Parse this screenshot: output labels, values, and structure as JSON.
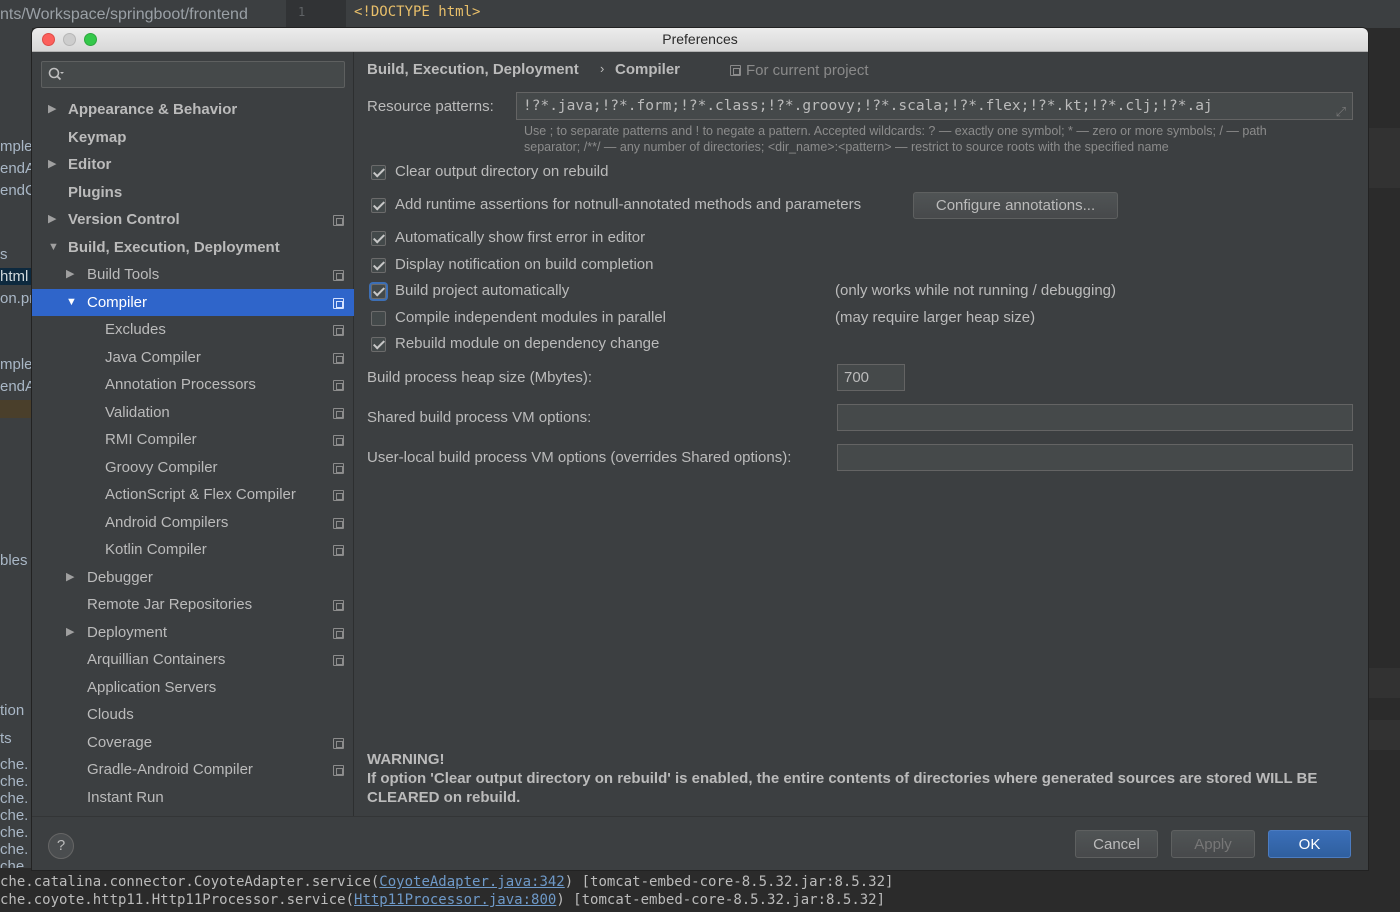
{
  "background": {
    "path": "nts/Workspace/springboot/frontend",
    "line_number": "1",
    "code": "<!DOCTYPE html>",
    "left_fragments": [
      "mple.",
      "endA",
      "endC",
      "s",
      "html",
      "on.pr",
      "mple.",
      "endA",
      "bles",
      "tion",
      "ts",
      "che.",
      "che.",
      "che.",
      "che.",
      "che.",
      "che.",
      "che."
    ],
    "console": [
      {
        "prefix": "che.catalina.connector.CoyoteAdapter.service(",
        "link": "CoyoteAdapter.java:342",
        "suffix": ") [tomcat-embed-core-8.5.32.jar:8.5.32]"
      },
      {
        "prefix": "che.coyote.http11.Http11Processor.service(",
        "link": "Http11Processor.java:800",
        "suffix": ") [tomcat-embed-core-8.5.32.jar:8.5.32]"
      }
    ]
  },
  "dialog": {
    "title": "Preferences",
    "search": {
      "value": "",
      "placeholder": ""
    }
  },
  "sidebar": {
    "items": [
      {
        "label": "Appearance & Behavior",
        "level": 0,
        "bold": true,
        "arrow": "right",
        "project": false
      },
      {
        "label": "Keymap",
        "level": 0,
        "bold": true,
        "arrow": "",
        "project": false
      },
      {
        "label": "Editor",
        "level": 0,
        "bold": true,
        "arrow": "right",
        "project": false
      },
      {
        "label": "Plugins",
        "level": 0,
        "bold": true,
        "arrow": "",
        "project": false
      },
      {
        "label": "Version Control",
        "level": 0,
        "bold": true,
        "arrow": "right",
        "project": true
      },
      {
        "label": "Build, Execution, Deployment",
        "level": 0,
        "bold": true,
        "arrow": "down",
        "project": false
      },
      {
        "label": "Build Tools",
        "level": 1,
        "bold": false,
        "arrow": "right",
        "project": true
      },
      {
        "label": "Compiler",
        "level": 1,
        "bold": false,
        "arrow": "down",
        "project": true,
        "selected": true
      },
      {
        "label": "Excludes",
        "level": 2,
        "bold": false,
        "arrow": "",
        "project": true
      },
      {
        "label": "Java Compiler",
        "level": 2,
        "bold": false,
        "arrow": "",
        "project": true
      },
      {
        "label": "Annotation Processors",
        "level": 2,
        "bold": false,
        "arrow": "",
        "project": true
      },
      {
        "label": "Validation",
        "level": 2,
        "bold": false,
        "arrow": "",
        "project": true
      },
      {
        "label": "RMI Compiler",
        "level": 2,
        "bold": false,
        "arrow": "",
        "project": true
      },
      {
        "label": "Groovy Compiler",
        "level": 2,
        "bold": false,
        "arrow": "",
        "project": true
      },
      {
        "label": "ActionScript & Flex Compiler",
        "level": 2,
        "bold": false,
        "arrow": "",
        "project": true
      },
      {
        "label": "Android Compilers",
        "level": 2,
        "bold": false,
        "arrow": "",
        "project": true
      },
      {
        "label": "Kotlin Compiler",
        "level": 2,
        "bold": false,
        "arrow": "",
        "project": true
      },
      {
        "label": "Debugger",
        "level": 1,
        "bold": false,
        "arrow": "right",
        "project": false
      },
      {
        "label": "Remote Jar Repositories",
        "level": 1,
        "bold": false,
        "arrow": "",
        "project": true
      },
      {
        "label": "Deployment",
        "level": 1,
        "bold": false,
        "arrow": "right",
        "project": true
      },
      {
        "label": "Arquillian Containers",
        "level": 1,
        "bold": false,
        "arrow": "",
        "project": true
      },
      {
        "label": "Application Servers",
        "level": 1,
        "bold": false,
        "arrow": "",
        "project": false
      },
      {
        "label": "Clouds",
        "level": 1,
        "bold": false,
        "arrow": "",
        "project": false
      },
      {
        "label": "Coverage",
        "level": 1,
        "bold": false,
        "arrow": "",
        "project": true
      },
      {
        "label": "Gradle-Android Compiler",
        "level": 1,
        "bold": false,
        "arrow": "",
        "project": true
      },
      {
        "label": "Instant Run",
        "level": 1,
        "bold": false,
        "arrow": "",
        "project": false
      }
    ]
  },
  "main": {
    "breadcrumb_1": "Build, Execution, Deployment",
    "breadcrumb_sep": "›",
    "breadcrumb_2": "Compiler",
    "for_project": "For current project",
    "resource_patterns_label": "Resource patterns:",
    "resource_patterns_value": "!?*.java;!?*.form;!?*.class;!?*.groovy;!?*.scala;!?*.flex;!?*.kt;!?*.clj;!?*.aj",
    "hint_line1": "Use ; to separate patterns and ! to negate a pattern. Accepted wildcards: ? — exactly one symbol; * — zero or more symbols; / — path",
    "hint_line2": "separator; /**/ — any number of directories; <dir_name>:<pattern> — restrict to source roots with the specified name",
    "checkboxes": {
      "clear_output": {
        "label": "Clear output directory on rebuild",
        "checked": true
      },
      "runtime_assertions": {
        "label": "Add runtime assertions for notnull-annotated methods and parameters",
        "checked": true
      },
      "show_first_error": {
        "label": "Automatically show first error in editor",
        "checked": true
      },
      "display_notification": {
        "label": "Display notification on build completion",
        "checked": true
      },
      "build_automatically": {
        "label": "Build project automatically",
        "checked": true,
        "note": "(only works while not running / debugging)"
      },
      "compile_parallel": {
        "label": "Compile independent modules in parallel",
        "checked": false,
        "note": "(may require larger heap size)"
      },
      "rebuild_dependency": {
        "label": "Rebuild module on dependency change",
        "checked": true
      }
    },
    "configure_annotations": "Configure annotations...",
    "heap_label": "Build process heap size (Mbytes):",
    "heap_value": "700",
    "shared_vm_label": "Shared build process VM options:",
    "shared_vm_value": "",
    "user_vm_label": "User-local build process VM options (overrides Shared options):",
    "user_vm_value": "",
    "warning_title": "WARNING!",
    "warning_text": "If option 'Clear output directory on rebuild' is enabled, the entire contents of directories where generated sources are stored WILL BE CLEARED on rebuild."
  },
  "footer": {
    "help": "?",
    "cancel": "Cancel",
    "apply": "Apply",
    "ok": "OK"
  },
  "colors": {
    "accent": "#2f65ca",
    "panel": "#3c3f41",
    "primary_button": "#365880"
  }
}
